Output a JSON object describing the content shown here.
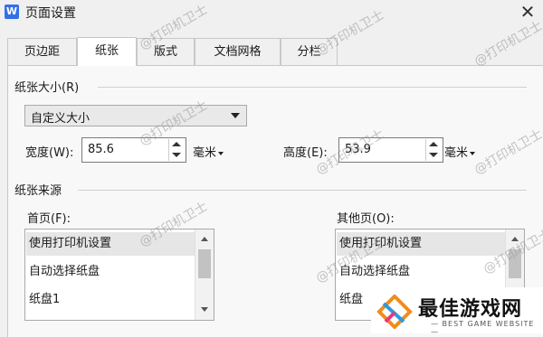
{
  "window": {
    "title": "页面设置",
    "close": "✕",
    "logo": "W"
  },
  "tabs": [
    {
      "label": "页边距"
    },
    {
      "label": "纸张"
    },
    {
      "label": "版式"
    },
    {
      "label": "文档网格"
    },
    {
      "label": "分栏"
    }
  ],
  "paper_size": {
    "group_title": "纸张大小(R)",
    "preset": "自定义大小",
    "width_label": "宽度(W):",
    "width_value": "85.6",
    "width_unit": "毫米",
    "height_label": "高度(E):",
    "height_value": "53.9",
    "height_unit": "毫米"
  },
  "paper_source": {
    "group_title": "纸张来源",
    "first_page_label": "首页(F):",
    "other_pages_label": "其他页(O):",
    "first_page_items": [
      "使用打印机设置",
      "自动选择纸盘",
      "纸盘1"
    ],
    "other_pages_items": [
      "使用打印机设置",
      "自动选择纸盘",
      "纸盘"
    ]
  },
  "watermark": "@打印机卫士",
  "brand": {
    "name": "最佳游戏网",
    "sub": "— BEST GAME WEBSITE —"
  }
}
